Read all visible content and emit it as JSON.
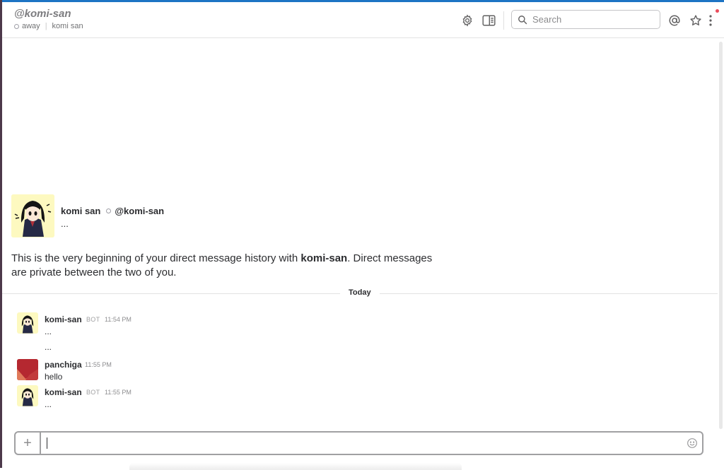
{
  "header": {
    "channel_name": "@komi-san",
    "presence": "away",
    "full_name": "komi san",
    "search_placeholder": "Search"
  },
  "intro": {
    "display_name": "komi san",
    "handle": "@komi-san",
    "status_text": "...",
    "text_before": "This is the very beginning of your direct message history with ",
    "text_bold": "komi-san",
    "text_after": ". Direct messages are private between the two of you."
  },
  "day_divider": "Today",
  "messages": [
    {
      "sender": "komi-san",
      "badge": "BOT",
      "time": "11:54 PM",
      "lines": [
        "...",
        "..."
      ]
    },
    {
      "sender": "panchiga",
      "time": "11:55 PM",
      "lines": [
        "hello"
      ]
    },
    {
      "sender": "komi-san",
      "badge": "BOT",
      "time": "11:55 PM",
      "lines": [
        "..."
      ]
    }
  ],
  "composer": {
    "plus_label": "+",
    "value": ""
  },
  "colors": {
    "top_accent": "#1d74c4",
    "sidebar_edge": "#4d394b",
    "notification_dot": "#eb4d5c"
  },
  "icons": [
    "gear-icon",
    "details-pane-icon",
    "search-icon",
    "mention-icon",
    "star-icon",
    "more-vertical-icon",
    "emoji-icon",
    "plus-icon"
  ]
}
